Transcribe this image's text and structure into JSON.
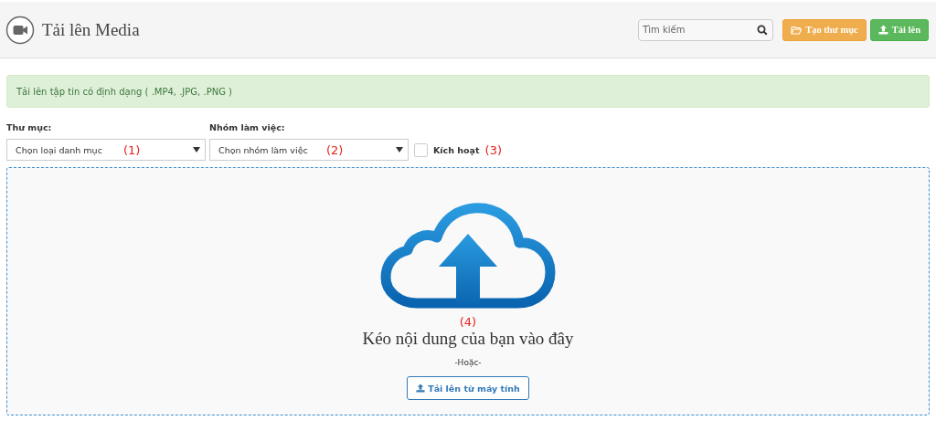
{
  "header": {
    "title": "Tải lên Media",
    "search": {
      "placeholder": "Tìm kiếm"
    },
    "buttons": [
      {
        "label": "Tạo thư mục",
        "kind": "folder"
      },
      {
        "label": "Tải lên",
        "kind": "upload"
      }
    ]
  },
  "alert": "Tải lên tập tin có định dạng ( .MP4, .JPG, .PNG )",
  "filters": [
    {
      "label": "Thư mục:",
      "value": "Chọn loại danh mục",
      "marker": "(1)"
    },
    {
      "label": "Nhóm làm việc:",
      "value": "Chọn nhóm làm việc",
      "marker": "(2)"
    }
  ],
  "activate": {
    "label": "Kích hoạt",
    "checked": false,
    "marker": "(3)"
  },
  "dropzone": {
    "marker": "(4)",
    "title": "Kéo nội dung của bạn vào đây",
    "or": "-Hoặc-",
    "button": "Tải lên từ máy tính"
  }
}
